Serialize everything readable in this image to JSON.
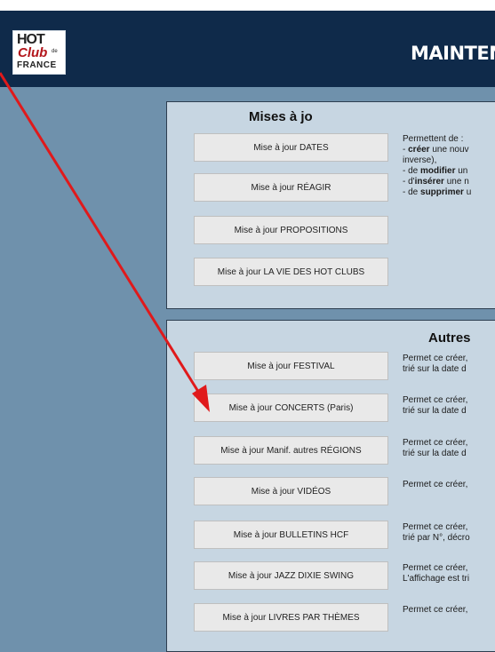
{
  "header": {
    "logo": {
      "line1": "HOT",
      "line2": "Club",
      "line3": "de",
      "line4": "FRANCE"
    },
    "title": "MAINTENA"
  },
  "sections": {
    "mises": {
      "title": "Mises à jo",
      "buttons": [
        "Mise à jour DATES",
        "Mise à jour RÉAGIR",
        "Mise à jour PROPOSITIONS",
        "Mise à jour LA VIE DES HOT CLUBS"
      ],
      "description": {
        "intro": "Permettent de :",
        "item1_prefix": "- ",
        "item1_bold": "créer",
        "item1_rest": " une nouv",
        "item1_cont": "inverse),",
        "item2_prefix": "- de ",
        "item2_bold": "modifier",
        "item2_rest": " un",
        "item3_prefix": "- d'",
        "item3_bold": "insérer",
        "item3_rest": " une n",
        "item4_prefix": "- de ",
        "item4_bold": "supprimer",
        "item4_rest": " u"
      }
    },
    "autres": {
      "title": "Autres",
      "rows": [
        {
          "button": "Mise à jour FESTIVAL",
          "line1": "Permet ce créer,",
          "line2": "trié sur la date d"
        },
        {
          "button": "Mise à jour CONCERTS (Paris)",
          "line1": "Permet ce créer,",
          "line2": "trié sur la date d"
        },
        {
          "button": "Mise à jour Manif. autres RÉGIONS",
          "line1": "Permet ce créer,",
          "line2": "trié sur la date d"
        },
        {
          "button": "Mise à jour VIDÉOS",
          "line1": "Permet ce créer,",
          "line2": ""
        },
        {
          "button": "Mise à jour BULLETINS HCF",
          "line1": "Permet ce créer,",
          "line2": "trié par N°, décro"
        },
        {
          "button": "Mise à jour JAZZ DIXIE SWING",
          "line1": "Permet ce créer,",
          "line2": "L'affichage est tri"
        },
        {
          "button": "Mise à jour LIVRES PAR THÈMES",
          "line1": "Permet ce créer,",
          "line2": ""
        }
      ]
    }
  },
  "annotation": {
    "color": "#e0191b",
    "target": "Mise à jour CONCERTS (Paris)"
  }
}
